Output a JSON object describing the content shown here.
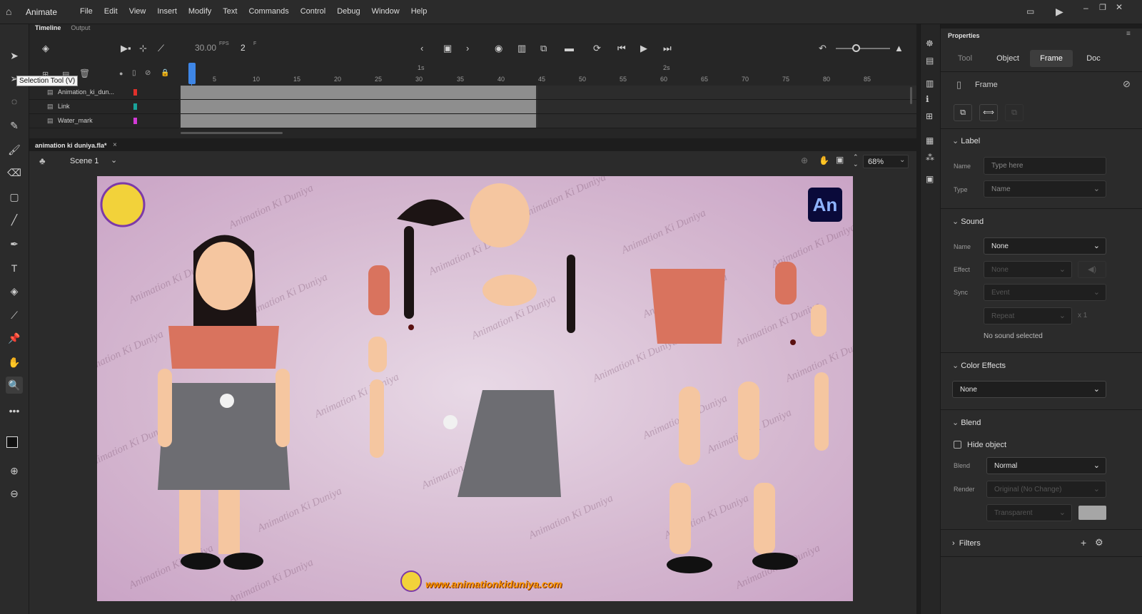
{
  "app": {
    "name": "Animate"
  },
  "menu": [
    "File",
    "Edit",
    "View",
    "Insert",
    "Modify",
    "Text",
    "Commands",
    "Control",
    "Debug",
    "Window",
    "Help"
  ],
  "tooltip": "Selection Tool (V)",
  "timeline": {
    "tabs": [
      "Timeline",
      "Output"
    ],
    "fps": "30.00",
    "fps_unit": "FPS",
    "frame": "2",
    "frame_unit": "F",
    "ruler": [
      "5",
      "10",
      "15",
      "20",
      "25",
      "30",
      "35",
      "40",
      "45",
      "50",
      "55",
      "60",
      "65",
      "70",
      "75",
      "80",
      "85"
    ],
    "seconds": [
      "1s",
      "2s"
    ],
    "layers": [
      {
        "name": "Animation_ki_dun...",
        "color": "#e0302b"
      },
      {
        "name": "Link",
        "color": "#1aa39a"
      },
      {
        "name": "Water_mark",
        "color": "#d23ad6"
      }
    ]
  },
  "document": {
    "tab": "animation ki duniya.fla*",
    "scene": "Scene 1",
    "zoom": "68%"
  },
  "stage": {
    "badge": "An",
    "website": "www.animationkiduniya.com",
    "watermark": "Animation Ki Duniya"
  },
  "properties": {
    "title": "Properties",
    "tabs": [
      "Tool",
      "Object",
      "Frame",
      "Doc"
    ],
    "active_tab": "Frame",
    "section_label": "Frame",
    "label": {
      "header": "Label",
      "name_label": "Name",
      "name_placeholder": "Type here",
      "type_label": "Type",
      "type_value": "Name"
    },
    "sound": {
      "header": "Sound",
      "name_label": "Name",
      "name_value": "None",
      "effect_label": "Effect",
      "effect_value": "None",
      "sync_label": "Sync",
      "sync_value": "Event",
      "repeat_value": "Repeat",
      "repeat_count": "x 1",
      "status": "No sound selected"
    },
    "color_effects": {
      "header": "Color Effects",
      "value": "None"
    },
    "blend": {
      "header": "Blend",
      "hide_object": "Hide object",
      "blend_label": "Blend",
      "blend_value": "Normal",
      "render_label": "Render",
      "render_value": "Original (No Change)",
      "transparent_value": "Transparent"
    },
    "filters": {
      "header": "Filters"
    }
  }
}
